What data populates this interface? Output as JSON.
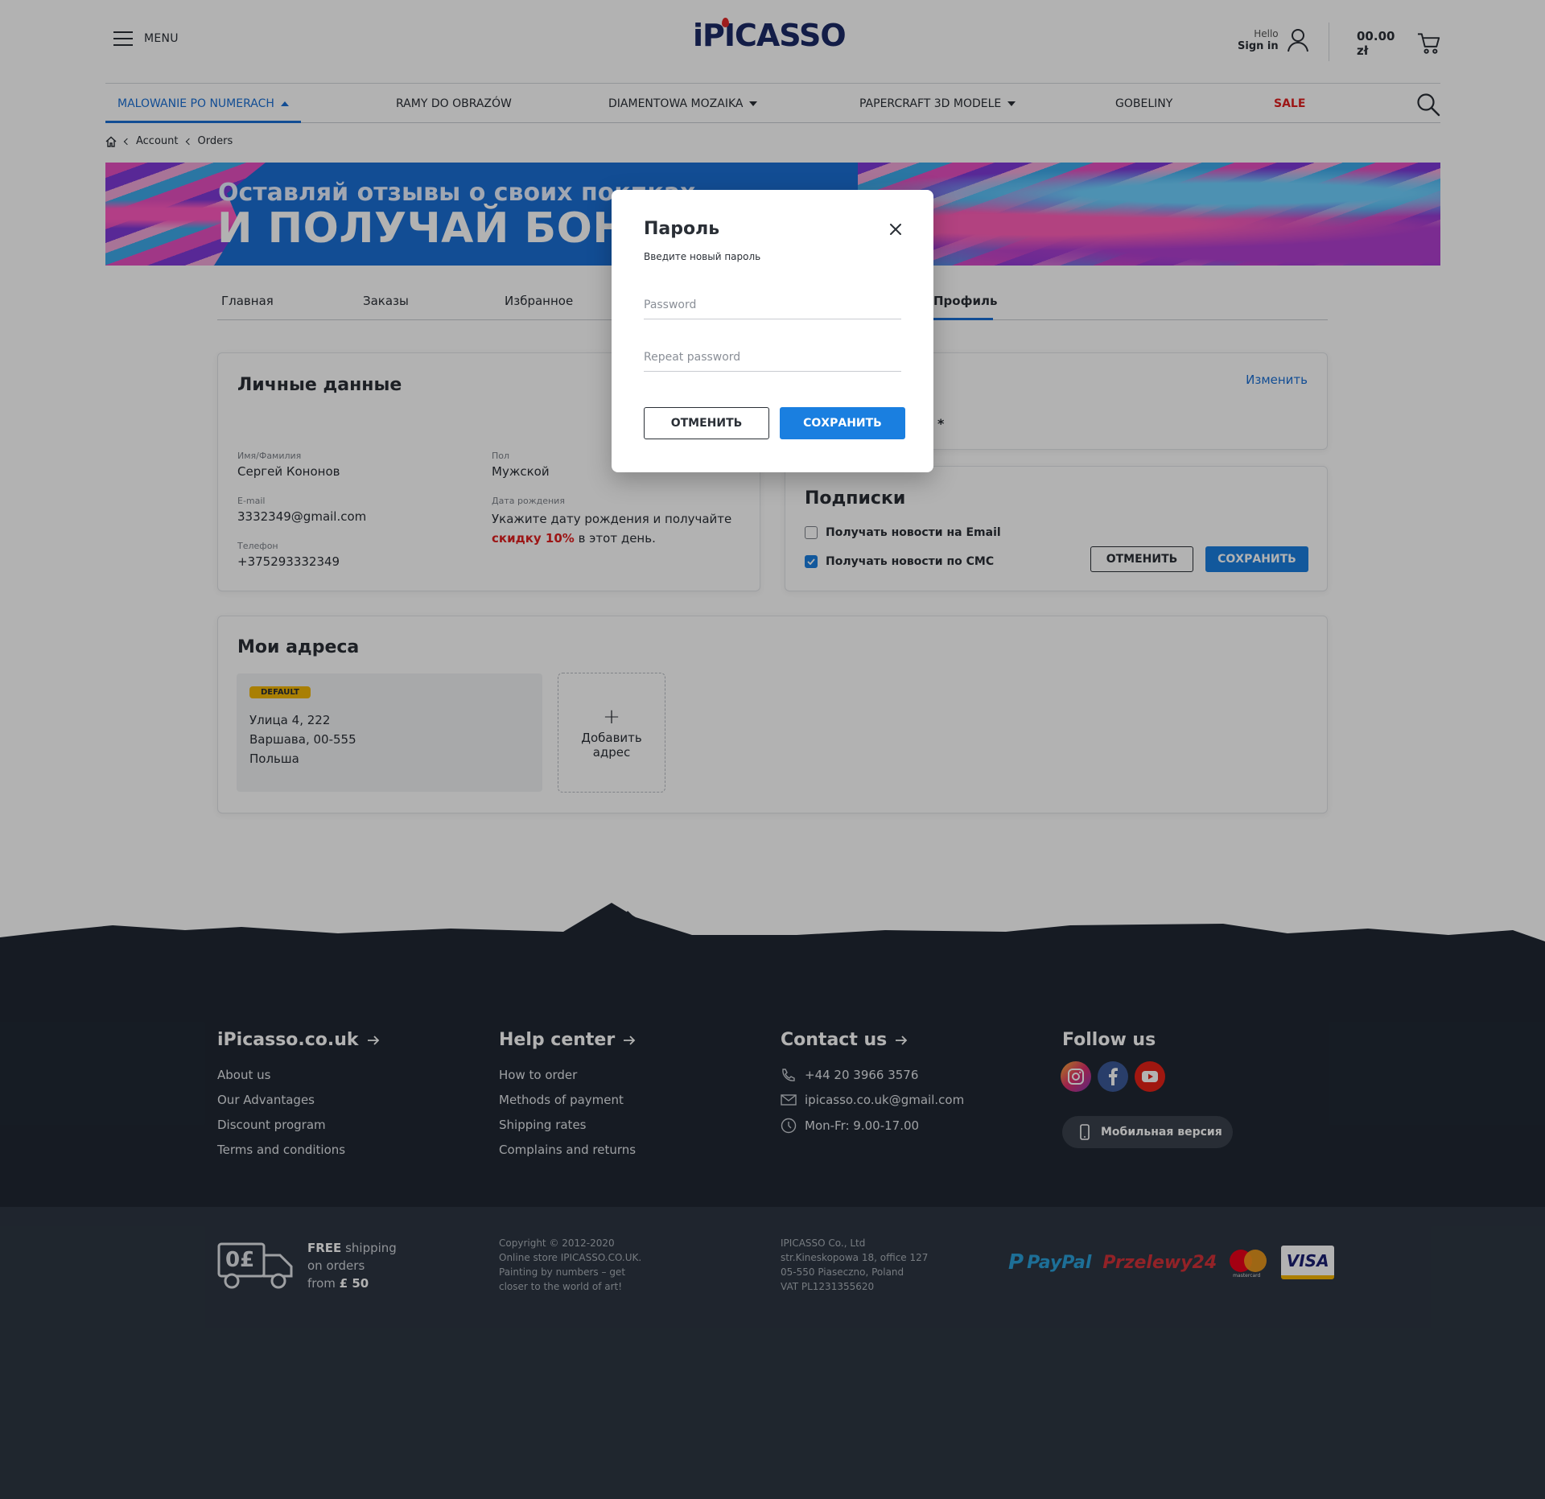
{
  "header": {
    "menu_label": "MENU",
    "logo_text": "iPICASSO",
    "hello": "Hello",
    "sign_in": "Sign in",
    "cart_amount": "00.00 zł"
  },
  "nav": {
    "items": [
      {
        "label": "MALOWANIE PO NUMERACH"
      },
      {
        "label": "RAMY DO OBRAZÓW"
      },
      {
        "label": "DIAMENTOWA MOZAIKA"
      },
      {
        "label": "PAPERCRAFT 3D MODELE"
      },
      {
        "label": "GOBELINY"
      },
      {
        "label": "SALE"
      }
    ]
  },
  "breadcrumb": [
    "Account",
    "Orders"
  ],
  "banner": {
    "line1": "Оставляй отзывы о своих покпках",
    "line2": "И ПОЛУЧАЙ БОНУСЫ"
  },
  "tabs": [
    {
      "label": "Главная"
    },
    {
      "label": "Заказы"
    },
    {
      "label": "Избранное"
    },
    {
      "label": "Профиль"
    }
  ],
  "personal": {
    "title": "Личные данные",
    "name_label": "Имя/Фамилия",
    "name_value": "Сергей Кононов",
    "gender_label": "Пол",
    "gender_value": "Мужской",
    "email_label": "E-mail",
    "email_value": "3332349@gmail.com",
    "birth_label": "Дата рождения",
    "birth_text": "Укажите дату рождения и получайте",
    "birth_discount": "скидку 10%",
    "birth_tail": "в этот день.",
    "phone_label": "Телефон",
    "phone_value": "+375293332349"
  },
  "password_card": {
    "edit_link": "Изменить",
    "masked": "*"
  },
  "subscriptions": {
    "title": "Подписки",
    "email_option": "Получать новости на Email",
    "email_checked": false,
    "sms_option": "Получать новости по СМС",
    "sms_checked": true,
    "cancel": "ОТМЕНИТЬ",
    "save": "СОХРАНИТЬ"
  },
  "addresses": {
    "title": "Мои адреса",
    "badge": "DEFAULT",
    "line1": "Улица 4, 222",
    "line2": "Варшава, 00-555",
    "line3": "Польша",
    "add_line1": "Добавить",
    "add_line2": "адрес"
  },
  "modal": {
    "title": "Пароль",
    "subtitle": "Введите новый пароль",
    "password_placeholder": "Password",
    "repeat_placeholder": "Repeat password",
    "cancel": "ОТМЕНИТЬ",
    "save": "СОХРАНИТЬ"
  },
  "footer": {
    "col1": {
      "title": "iPicasso.co.uk",
      "links": [
        "About us",
        "Our Advantages",
        "Discount program",
        "Terms and conditions"
      ]
    },
    "col2": {
      "title": "Help center",
      "links": [
        "How to order",
        "Methods of payment",
        "Shipping rates",
        "Complains and returns"
      ]
    },
    "col3": {
      "title": "Contact us",
      "phone": "+44 20 3966 3576",
      "email": "ipicasso.co.uk@gmail.com",
      "hours": "Mon-Fr: 9.00-17.00"
    },
    "col4": {
      "title": "Follow us",
      "mobile": "Мобильная версия"
    },
    "shipping": {
      "big": "0£",
      "free": "FREE",
      "l1": "shipping",
      "l2": "on orders",
      "l3": "from",
      "amount": "£ 50"
    },
    "copyright": [
      "Copyright © 2012-2020",
      "Online store IPICASSO.CO.UK.",
      "Painting by numbers – get",
      "closer to the world of art!"
    ],
    "company": [
      "IPICASSO Co., Ltd",
      "str.Kineskopowa 18, office 127",
      "05-550 Piaseczno, Poland",
      "VAT PL1231355620"
    ],
    "payments": [
      "PayPal",
      "Przelewy24",
      "mastercard",
      "VISA"
    ]
  },
  "colors": {
    "accent": "#1a7fe0",
    "sale": "#e02020",
    "footer": "#202833",
    "badge": "#f2b705"
  }
}
